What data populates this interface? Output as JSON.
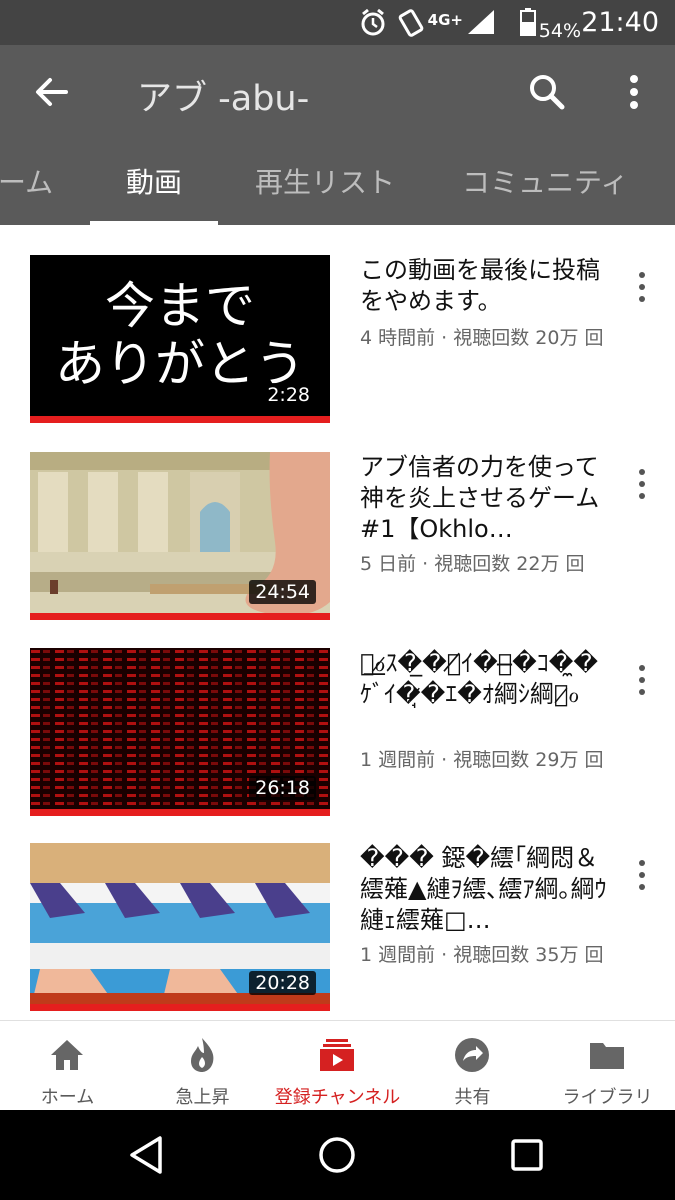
{
  "status_bar": {
    "lte": "4G+",
    "battery_percent": "54%",
    "time": "21:40"
  },
  "header": {
    "channel_title": "アブ -abu-",
    "back_icon": "arrow-back-icon",
    "search_icon": "search-icon",
    "more_icon": "more-vert-icon"
  },
  "tabs": [
    {
      "label": "ーム",
      "active": false
    },
    {
      "label": "動画",
      "active": true
    },
    {
      "label": "再生リスト",
      "active": false
    },
    {
      "label": "コミュニティ",
      "active": false
    }
  ],
  "videos": [
    {
      "title": "この動画を最後に投稿をやめます。",
      "meta": "4 時間前 · 視聴回数 20万 回",
      "duration": "2:28",
      "thumb_text": [
        "今まで",
        "ありがとう"
      ]
    },
    {
      "title": "アブ信者の力を使って神を炎上させるゲーム #1【Okhlo…",
      "meta": "5 日前 · 視聴回数 22万 回",
      "duration": "24:54"
    },
    {
      "title": "す͟ℴ̷ｽ�̲�ｸ̸ｲ�ｹ̶�ｺ�̼�ｹﾞｲ�̷̘�ｴ�ｵ綱ｼ綱ｳ̷ℴ",
      "meta": "1 週間前 · 視聴回数 29万 回",
      "duration": "26:18"
    },
    {
      "title": "��� 鐚�繧｢綱悶＆繧薙▲縺ｦ繧､繧ｱ綱｡綱ｳ縺ｪ繧薙□…",
      "meta": "1 週間前 · 視聴回数 35万 回",
      "duration": "20:28"
    }
  ],
  "bottom_nav": [
    {
      "label": "ホーム",
      "icon": "home-icon",
      "active": false
    },
    {
      "label": "急上昇",
      "icon": "trending-flame-icon",
      "active": false
    },
    {
      "label": "登録チャンネル",
      "icon": "subscriptions-icon",
      "active": true
    },
    {
      "label": "共有",
      "icon": "share-icon",
      "active": false
    },
    {
      "label": "ライブラリ",
      "icon": "library-folder-icon",
      "active": false
    }
  ],
  "system_nav": {
    "back_icon": "nav-back-triangle-icon",
    "home_icon": "nav-home-circle-icon",
    "recents_icon": "nav-recents-square-icon"
  },
  "colors": {
    "status_bar": "#444444",
    "app_bar": "#5a5a5a",
    "accent_red": "#d52121",
    "progress_red": "#e51e1e"
  }
}
